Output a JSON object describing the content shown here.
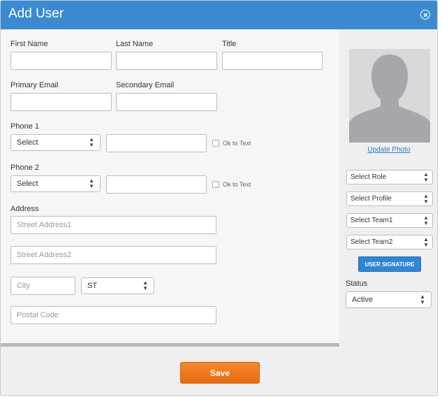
{
  "dialog": {
    "title": "Add User"
  },
  "labels": {
    "first_name": "First Name",
    "last_name": "Last Name",
    "title": "Title",
    "primary_email": "Primary Email",
    "secondary_email": "Secondary Email",
    "phone1": "Phone 1",
    "phone2": "Phone 2",
    "address": "Address",
    "ok_to_text": "Ok to Text",
    "status": "Status"
  },
  "fields": {
    "phone1_type": "Select",
    "phone2_type": "Select",
    "street1_placeholder": "Street Address1",
    "street2_placeholder": "Street Address2",
    "city_placeholder": "City",
    "state": "ST",
    "postal_placeholder": "Postal Code"
  },
  "side": {
    "update_photo": "Update Photo",
    "role": "Select Role",
    "profile": "Select Profile",
    "team1": "Select Team1",
    "team2": "Select Team2",
    "signature_button": "USER SIGNATURE",
    "status_value": "Active"
  },
  "footer": {
    "save_label": "Save"
  },
  "colors": {
    "header": "#3b8ad1",
    "save": "#f07a1d",
    "link": "#2f7cc4",
    "signature": "#2f86d4"
  },
  "icons": {
    "close": "close-circle-icon",
    "select_caret": "up-down-caret-icon",
    "avatar": "person-silhouette-icon"
  }
}
